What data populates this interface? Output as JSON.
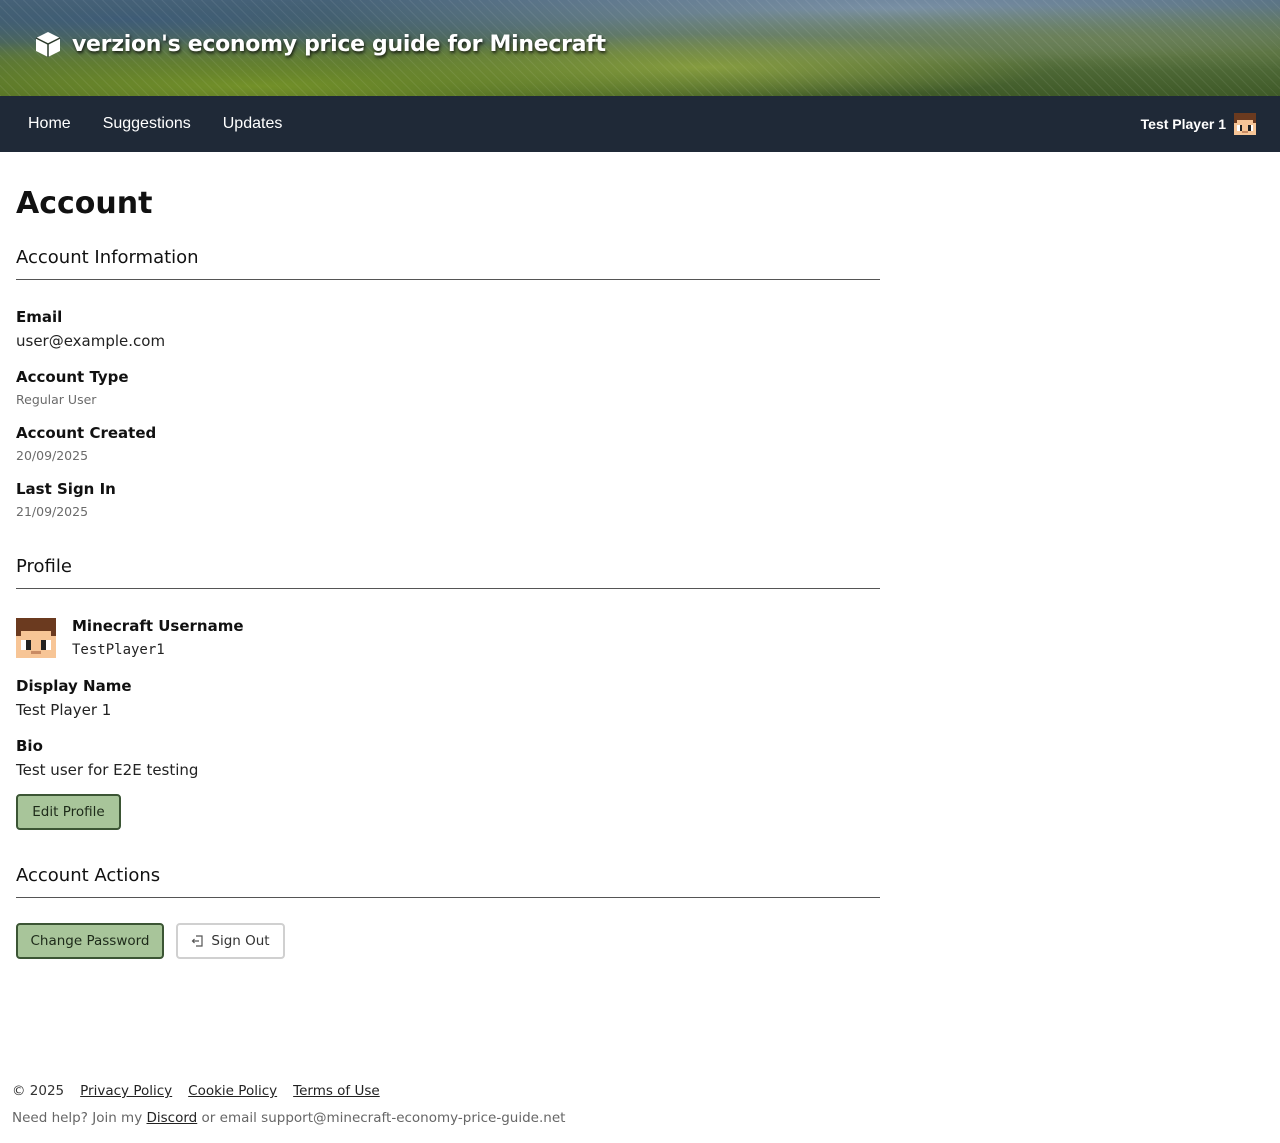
{
  "banner": {
    "title": "verzion's economy price guide for Minecraft",
    "icon": "cube-icon"
  },
  "nav": {
    "links": [
      "Home",
      "Suggestions",
      "Updates"
    ],
    "user_name": "Test Player 1",
    "bg_color": "#1f2937"
  },
  "page": {
    "title": "Account"
  },
  "account_info": {
    "heading": "Account Information",
    "email_label": "Email",
    "email_value": "user@example.com",
    "type_label": "Account Type",
    "type_value": "Regular User",
    "created_label": "Account Created",
    "created_value": "20/09/2025",
    "last_sign_in_label": "Last Sign In",
    "last_sign_in_value": "21/09/2025"
  },
  "profile": {
    "heading": "Profile",
    "mc_username_label": "Minecraft Username",
    "mc_username_value": "TestPlayer1",
    "display_name_label": "Display Name",
    "display_name_value": "Test Player 1",
    "bio_label": "Bio",
    "bio_value": "Test user for E2E testing",
    "edit_button": "Edit Profile"
  },
  "account_actions": {
    "heading": "Account Actions",
    "change_password_button": "Change Password",
    "sign_out_button": "Sign Out"
  },
  "footer": {
    "copyright": "© 2025",
    "links": [
      "Privacy Policy",
      "Cookie Policy",
      "Terms of Use"
    ],
    "help_prefix": "Need help? Join my",
    "discord_link": "Discord",
    "help_suffix": "or email support@minecraft-economy-price-guide.net"
  },
  "colors": {
    "accent_button": "#a8c59a",
    "accent_border": "#3b5534"
  }
}
